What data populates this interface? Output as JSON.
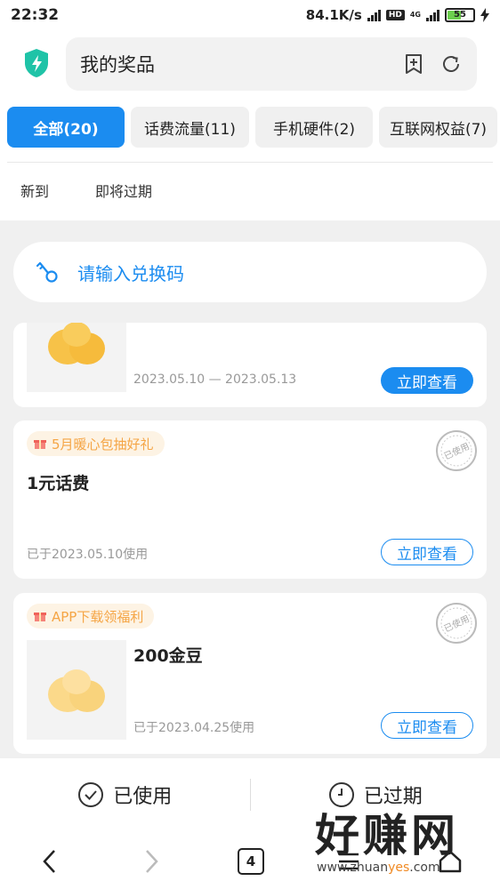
{
  "status_bar": {
    "time": "22:32",
    "speed": "84.1K/s",
    "hd": "HD",
    "net": "4G",
    "battery": "55"
  },
  "header": {
    "title": "我的奖品",
    "icons": [
      "shield-bolt-icon",
      "bookmark-add-icon",
      "refresh-icon"
    ]
  },
  "tabs": [
    {
      "label": "全部(20)",
      "active": true
    },
    {
      "label": "话费流量(11)",
      "active": false
    },
    {
      "label": "手机硬件(2)",
      "active": false
    },
    {
      "label": "互联网权益(7)",
      "active": false
    }
  ],
  "filters": [
    "新到",
    "即将过期"
  ],
  "redeem": {
    "placeholder": "请输入兑换码",
    "icon": "key-icon"
  },
  "cards": [
    {
      "date": "2023.05.10 — 2023.05.13",
      "button": "立即查看"
    },
    {
      "badge": "5月暖心包抽好礼",
      "name": "1元话费",
      "date": "已于2023.05.10使用",
      "button": "立即查看",
      "stamp": "已使用"
    },
    {
      "badge": "APP下载领福利",
      "name": "200金豆",
      "date": "已于2023.04.25使用",
      "button": "立即查看",
      "stamp": "已使用"
    }
  ],
  "bottom": {
    "used": "已使用",
    "expired": "已过期"
  },
  "nav": {
    "tabs_count": "4"
  },
  "watermark": {
    "title": "好赚网",
    "url_prefix": "www.zhuan",
    "url_highlight": "yes",
    "url_suffix": ".com"
  },
  "colors": {
    "accent": "#1b8cf0",
    "badge_text": "#f5a545",
    "badge_bg": "#fdf3e4"
  }
}
